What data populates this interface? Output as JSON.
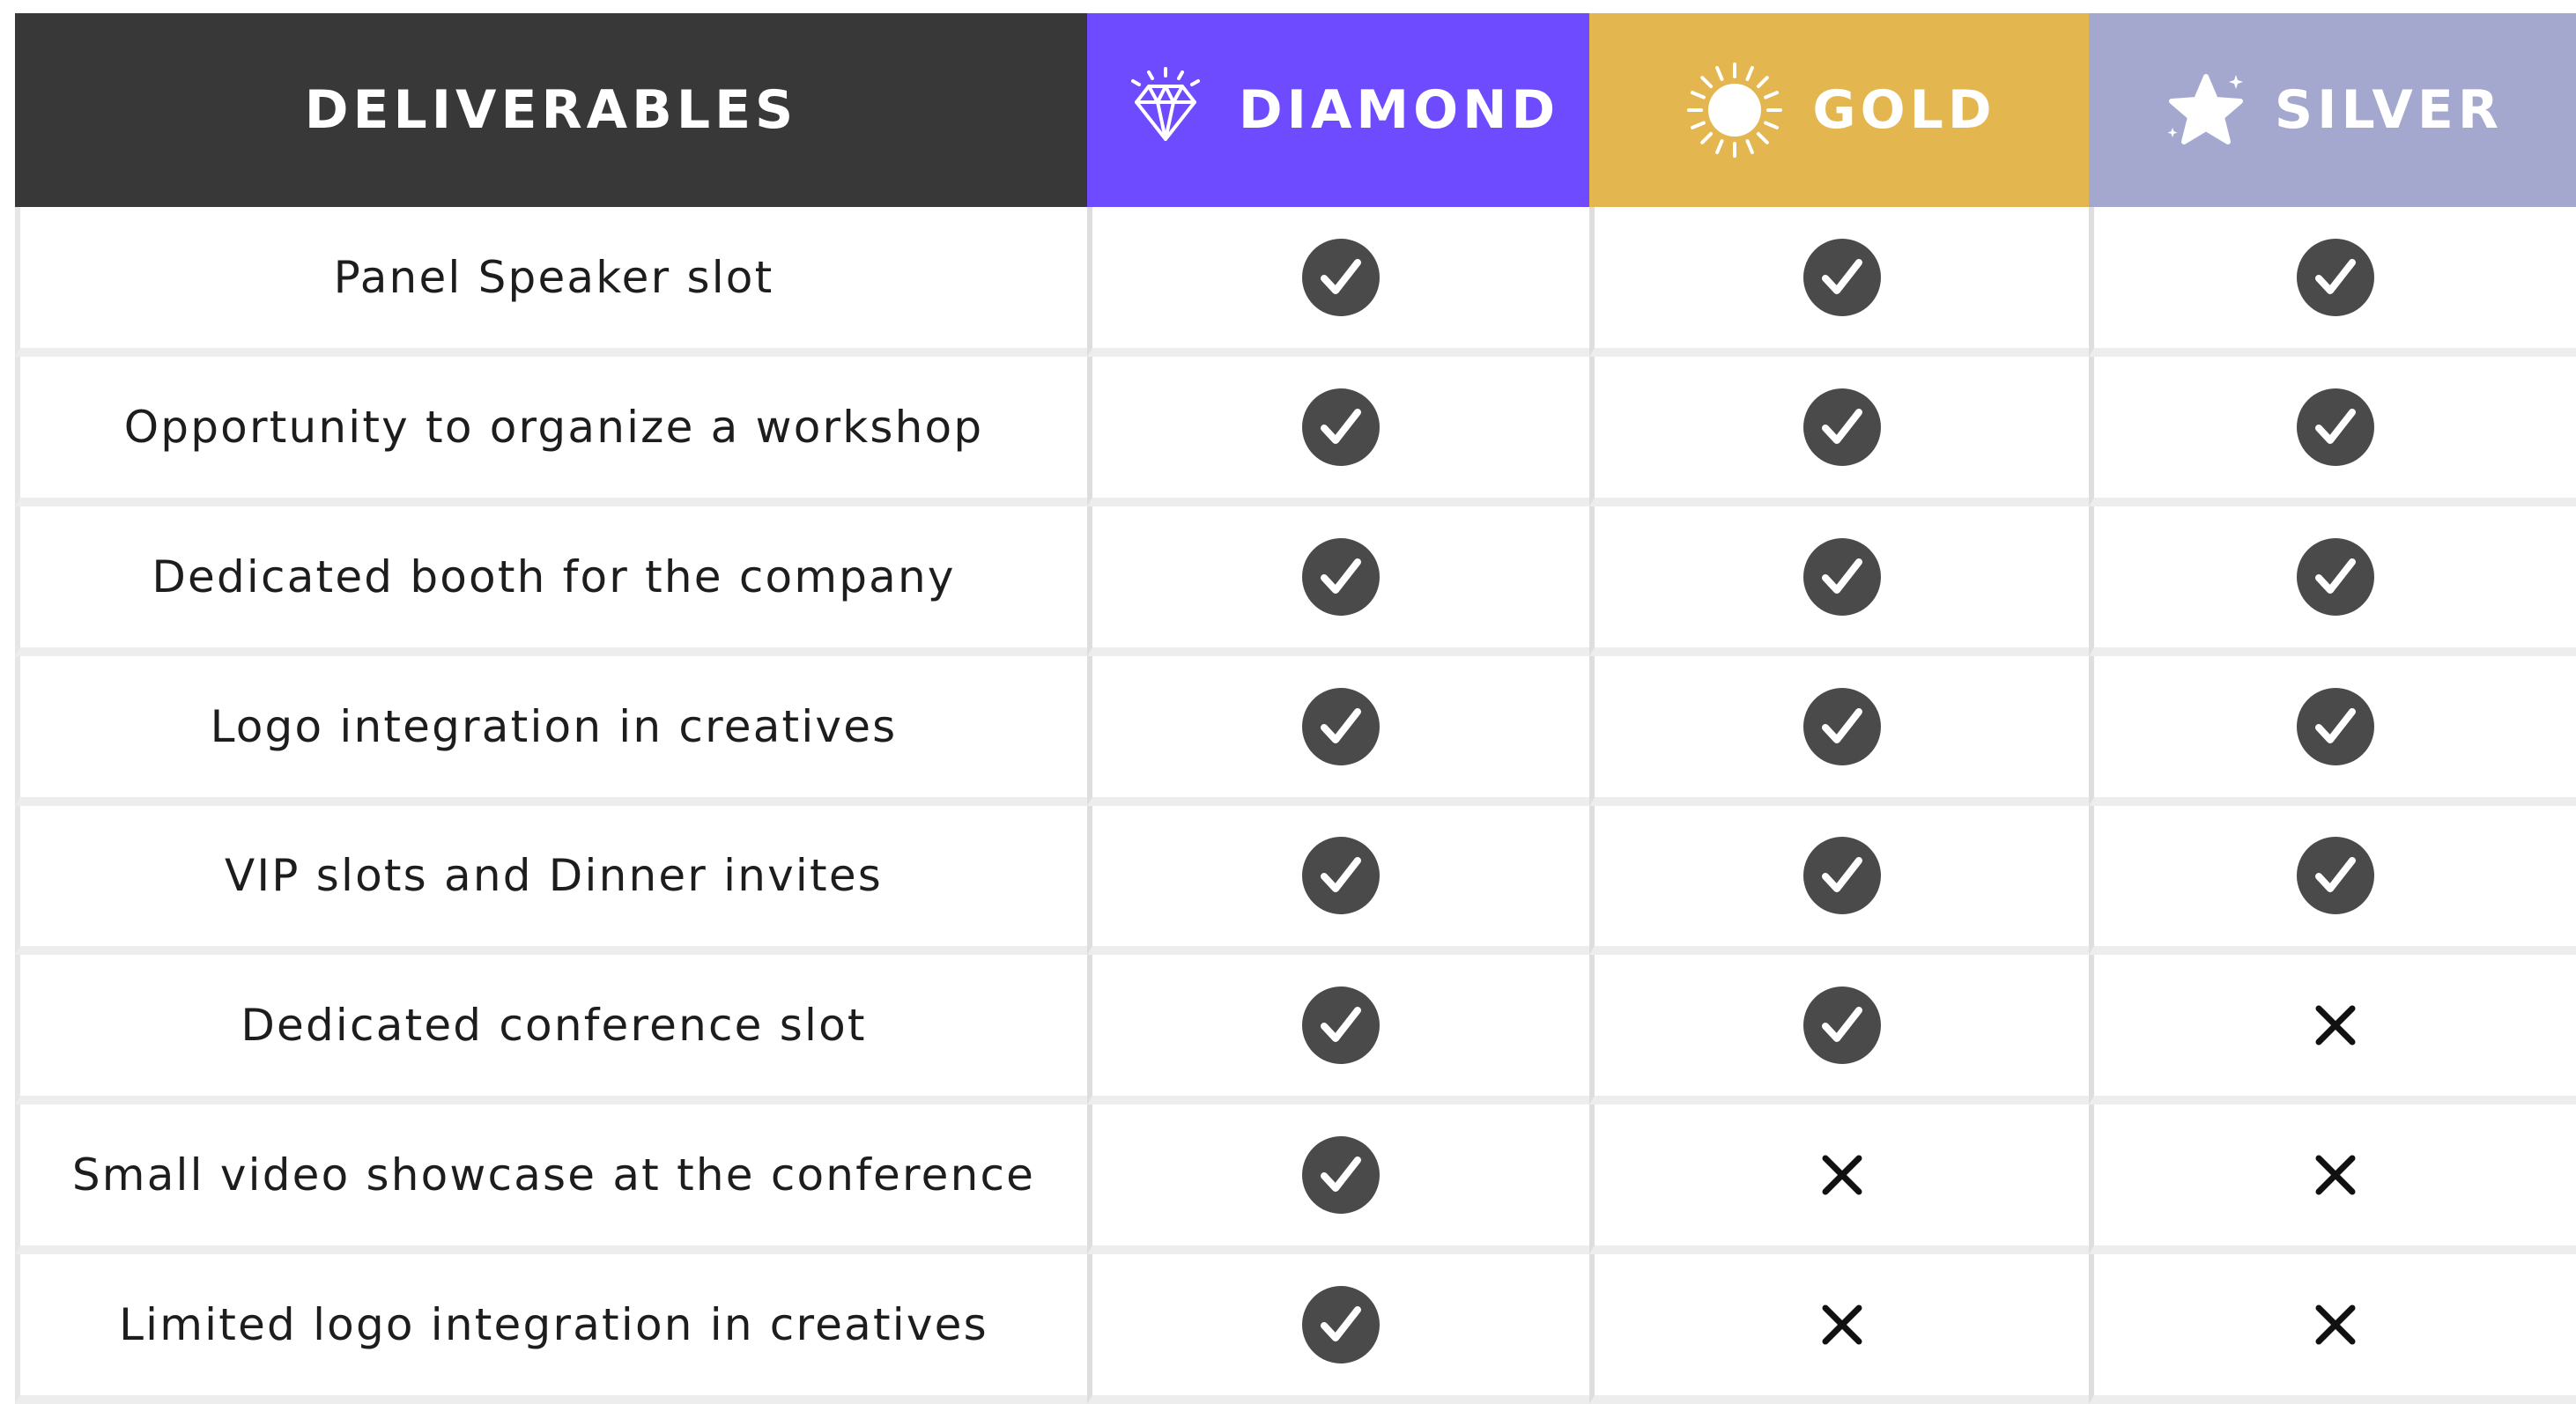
{
  "colors": {
    "deliverables_bg": "#383838",
    "diamond_bg": "#6f4bff",
    "gold_bg": "#e3b64f",
    "silver_bg": "#a4a8cf",
    "check_fill": "#4a4a4a",
    "cross": "#111111"
  },
  "header": {
    "deliverables": "DELIVERABLES",
    "tiers": [
      {
        "label": "DIAMOND",
        "icon": "diamond-icon"
      },
      {
        "label": "GOLD",
        "icon": "sun-icon"
      },
      {
        "label": "SILVER",
        "icon": "star-icon"
      }
    ]
  },
  "rows": [
    {
      "label": "Panel Speaker slot",
      "values": [
        "check",
        "check",
        "check"
      ]
    },
    {
      "label": "Opportunity to organize a workshop",
      "values": [
        "check",
        "check",
        "check"
      ]
    },
    {
      "label": "Dedicated booth for the company",
      "values": [
        "check",
        "check",
        "check"
      ]
    },
    {
      "label": "Logo integration in creatives",
      "values": [
        "check",
        "check",
        "check"
      ]
    },
    {
      "label": "VIP slots and Dinner invites",
      "values": [
        "check",
        "check",
        "check"
      ]
    },
    {
      "label": "Dedicated conference slot",
      "values": [
        "check",
        "check",
        "cross"
      ]
    },
    {
      "label": "Small video showcase at the conference",
      "values": [
        "check",
        "cross",
        "cross"
      ]
    },
    {
      "label": "Limited logo integration in creatives",
      "values": [
        "check",
        "cross",
        "cross"
      ]
    }
  ]
}
